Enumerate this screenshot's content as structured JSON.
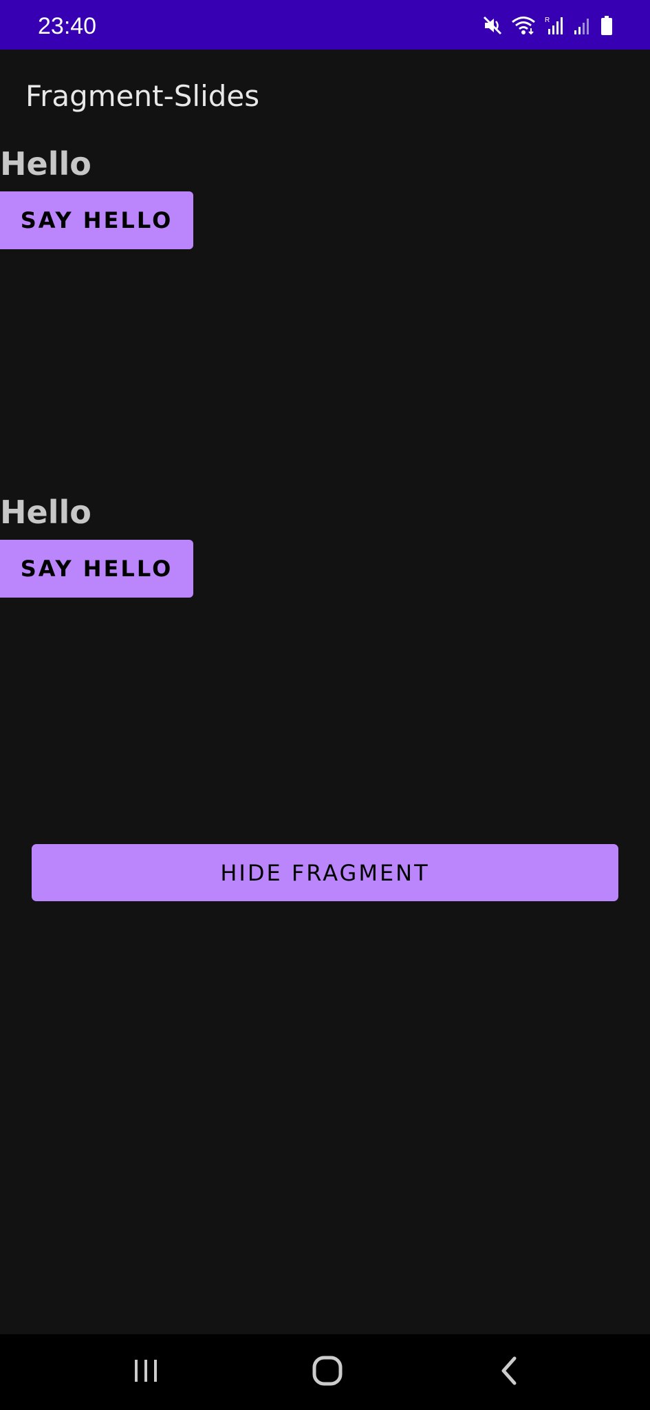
{
  "status_bar": {
    "time": "23:40",
    "icons": [
      "mute-icon",
      "wifi-icon",
      "signal-r-icon",
      "signal-icon",
      "battery-icon"
    ],
    "background": "#3700B3"
  },
  "app_bar": {
    "title": "Fragment-Slides"
  },
  "fragments": [
    {
      "title": "Hello",
      "button_label": "SAY HELLO"
    },
    {
      "title": "Hello",
      "button_label": "SAY HELLO"
    }
  ],
  "hide_button": {
    "label": "HIDE FRAGMENT"
  },
  "nav_bar": {
    "items": [
      "recents-icon",
      "home-icon",
      "back-icon"
    ]
  },
  "colors": {
    "accent": "#BB86FC",
    "background": "#121212"
  }
}
